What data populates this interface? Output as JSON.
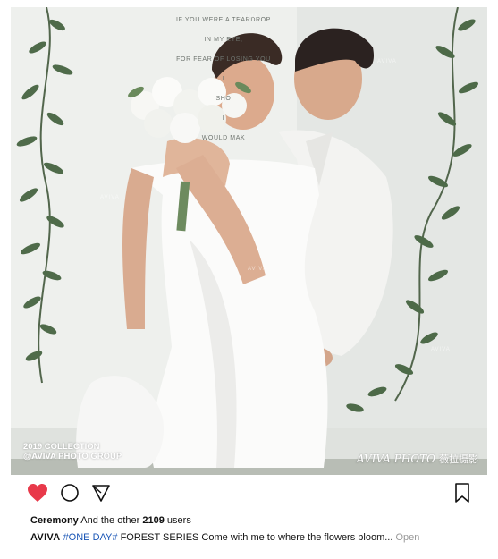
{
  "photo": {
    "wall_text": [
      "IF YOU WERE A TEARDROP",
      "IN MY EYE,",
      "FOR FEAR OF LOSING YOU",
      "I",
      "SHO",
      "I",
      "WOULD MAK"
    ],
    "watermark": "AVIVA",
    "collection_line1": "2019 COLLECTION",
    "collection_line2": "@AVIVA PHOTO GROUP",
    "brand_script": "AVIVA PHOTO",
    "brand_cn": "薇拉摄影"
  },
  "actions": {
    "icons": [
      "heart-icon",
      "comment-icon",
      "share-icon",
      "bookmark-icon"
    ],
    "heart_color": "#e8394a"
  },
  "likes": {
    "first_user": "Ceremony",
    "middle_text": "And the other",
    "count": "2109",
    "suffix": "users"
  },
  "caption": {
    "username": "AVIVA",
    "hashtag": "#ONE DAY#",
    "text": "FOREST SERIES  Come with me to where the flowers bloom...",
    "more": "Open"
  }
}
